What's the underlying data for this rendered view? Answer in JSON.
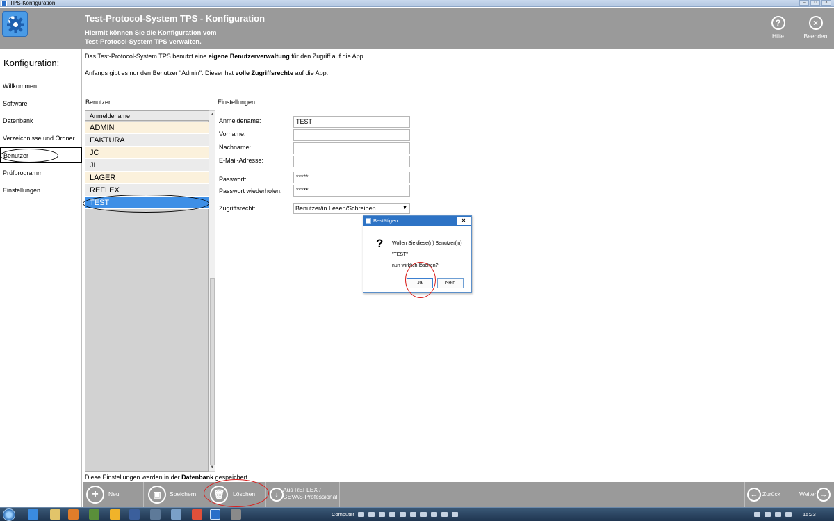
{
  "window": {
    "title": "TPS-Konfiguration"
  },
  "header": {
    "title": "Test-Protocol-System TPS - Konfiguration",
    "subtitle_line1": "Hiermit können Sie die Konfiguration vom",
    "subtitle_line2": "Test-Protocol-System TPS verwalten.",
    "help_label": "Hilfe",
    "exit_label": "Beenden"
  },
  "nav": {
    "title": "Konfiguration:",
    "items": [
      {
        "label": "Willkommen"
      },
      {
        "label": "Software"
      },
      {
        "label": "Datenbank"
      },
      {
        "label": "Verzeichnisse und Ordner"
      },
      {
        "label": "Benutzer"
      },
      {
        "label": "Prüfprogramm"
      },
      {
        "label": "Einstellungen"
      }
    ]
  },
  "intro": {
    "line1_pre": "Das Test-Protocol-System TPS benutzt eine ",
    "line1_bold": "eigene Benutzerverwaltung",
    "line1_post": " für den Zugriff auf die App.",
    "line2_pre": "Anfangs gibt es nur den Benutzer \"Admin\". Dieser hat ",
    "line2_bold": "volle Zugriffsrechte",
    "line2_post": " auf die App."
  },
  "users": {
    "section_label": "Benutzer:",
    "column_header": "Anmeldename",
    "rows": [
      "ADMIN",
      "FAKTURA",
      "JC",
      "JL",
      "LAGER",
      "REFLEX",
      "TEST"
    ],
    "selected": "TEST"
  },
  "settings": {
    "section_label": "Einstellungen:",
    "login_label": "Anmeldename:",
    "login_value": "TEST",
    "firstname_label": "Vorname:",
    "firstname_value": "",
    "lastname_label": "Nachname:",
    "lastname_value": "",
    "email_label": "E-Mail-Adresse:",
    "email_value": "",
    "password_label": "Passwort:",
    "password_value": "*****",
    "password_repeat_label": "Passwort wiederholen:",
    "password_repeat_value": "*****",
    "access_label": "Zugriffsrecht:",
    "access_value": "Benutzer/in Lesen/Schreiben"
  },
  "footer_note": {
    "pre": "Diese Einstellungen werden in der ",
    "bold": "Datenbank",
    "post": " gespeichert."
  },
  "toolbar": {
    "new_label": "Neu",
    "save_label": "Speichern",
    "delete_label": "Löschen",
    "import_label_line1": "Aus REFLEX /",
    "import_label_line2": "GEVAS-Professional",
    "back_label": "Zurück",
    "next_label": "Weiter"
  },
  "dialog": {
    "title": "Bestätigen",
    "line1": "Wollen Sie diese(n) Benutzer(in)",
    "line2": "\"TEST\"",
    "line3": "nun wirklich löschen?",
    "yes_label": "Ja",
    "no_label": "Nein"
  },
  "taskbar": {
    "computer_label": "Computer",
    "clock": "15:23"
  },
  "colors": {
    "header_bg": "#9a9a9a",
    "selection": "#3e8fe6",
    "highlight_annotation": "#d9201e"
  }
}
